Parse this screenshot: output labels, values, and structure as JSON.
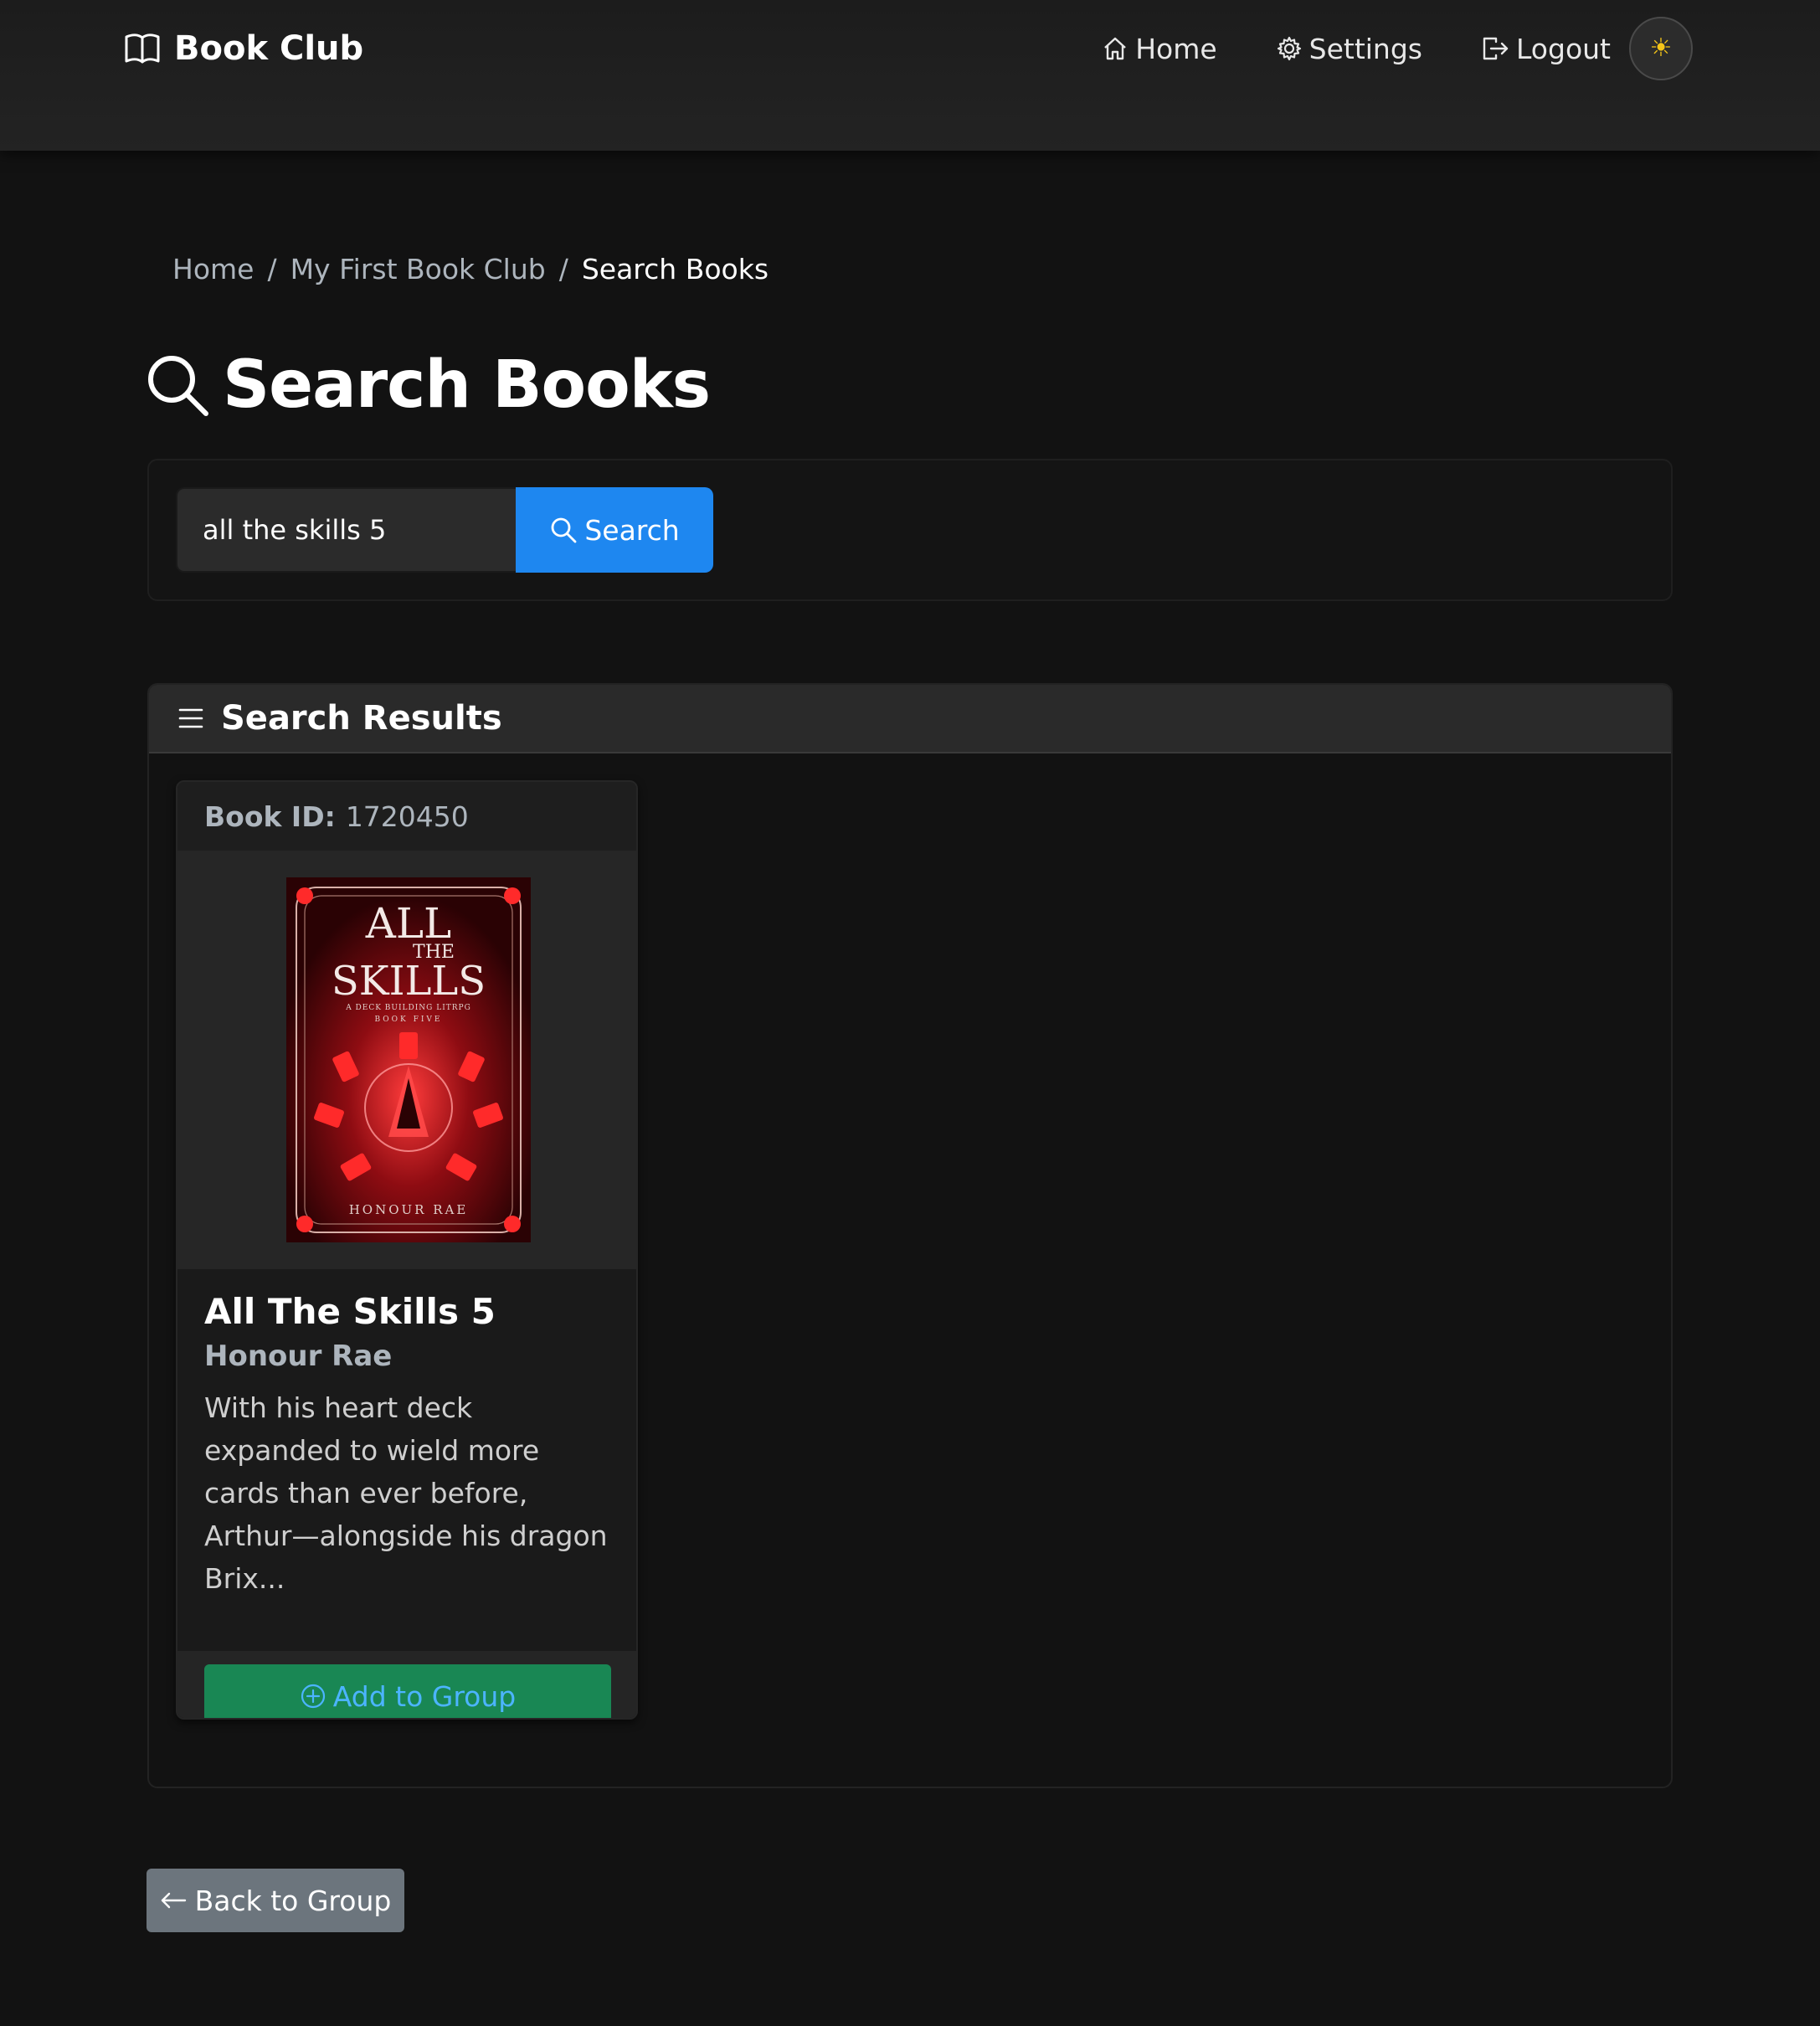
{
  "navbar": {
    "brand": "Book Club",
    "brand_icon": "book-open-icon",
    "links": [
      {
        "label": "Home",
        "icon": "house-icon"
      },
      {
        "label": "Settings",
        "icon": "gear-icon"
      },
      {
        "label": "Logout",
        "icon": "logout-icon"
      }
    ],
    "theme_toggle_icon": "sun-icon",
    "theme_toggle_symbol": "☀",
    "accent_sun": "#f5c518"
  },
  "breadcrumb": {
    "items": [
      "Home",
      "My First Book Club"
    ],
    "active": "Search Books",
    "separator": "/"
  },
  "page": {
    "title": "Search Books",
    "title_icon": "search-icon"
  },
  "search": {
    "value": "all the skills 5",
    "placeholder": "",
    "button_label": "Search",
    "button_color": "#1e87f0"
  },
  "results": {
    "title": "Search Results",
    "icon": "list-icon",
    "books": [
      {
        "id_label": "Book ID:",
        "id": "1720450",
        "title": "All The Skills 5",
        "author": "Honour Rae",
        "description": "With his heart deck expanded to wield more cards than ever before, Arthur—alongside his dragon Brix...",
        "cover": {
          "line1": "ALL",
          "line2": "THE",
          "line3": "SKILLS",
          "tagline1": "A DECK BUILDING LITRPG",
          "tagline2": "BOOK FIVE",
          "author": "HONOUR RAE",
          "color": "#c8161d"
        },
        "add_label": "Add to Group",
        "add_color": "#198754"
      }
    ]
  },
  "back_button": {
    "label": "Back to Group",
    "icon": "arrow-left-icon"
  }
}
